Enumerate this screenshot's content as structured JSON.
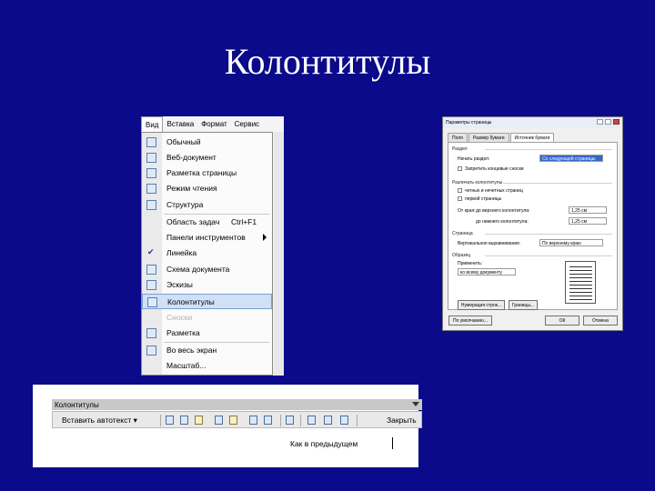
{
  "slide": {
    "title": "Колонтитулы"
  },
  "menu": {
    "menubar": [
      "Вид",
      "Вставка",
      "Формат",
      "Сервис"
    ],
    "items": [
      {
        "label": "Обычный",
        "shortcut": ""
      },
      {
        "label": "Веб-документ",
        "shortcut": ""
      },
      {
        "label": "Разметка страницы",
        "shortcut": ""
      },
      {
        "label": "Режим чтения",
        "shortcut": ""
      },
      {
        "label": "Структура",
        "shortcut": ""
      },
      {
        "label": "Область задач",
        "shortcut": "Ctrl+F1"
      },
      {
        "label": "Панели инструментов",
        "shortcut": ""
      },
      {
        "label": "Линейка",
        "shortcut": ""
      },
      {
        "label": "Схема документа",
        "shortcut": ""
      },
      {
        "label": "Эскизы",
        "shortcut": ""
      },
      {
        "label": "Колонтитулы",
        "shortcut": ""
      },
      {
        "label": "Сноски",
        "shortcut": ""
      },
      {
        "label": "Разметка",
        "shortcut": ""
      },
      {
        "label": "Во весь экран",
        "shortcut": ""
      },
      {
        "label": "Масштаб...",
        "shortcut": ""
      }
    ]
  },
  "dialog": {
    "title": "Параметры страницы",
    "tabs": [
      "Поля",
      "Размер бумаги",
      "Источник бумаги"
    ],
    "section_razdel": "Раздел",
    "nachat_razdel_label": "Начать раздел:",
    "nachat_razdel_value": "Со следующей страницы",
    "hide_endnotes": "Запретить концевые сноски",
    "section_kolontituly": "Различать колонтитулы",
    "odd_even": "четных и нечетных страниц",
    "first_page": "первой страницы",
    "from_edge": "От края:",
    "header_label": "до верхнего колонтитула:",
    "header_value": "1,25 см",
    "footer_label": "до нижнего колонтитула:",
    "footer_value": "1,25 см",
    "section_page": "Страница",
    "valign_label": "Вертикальное выравнивание:",
    "valign_value": "По верхнему краю",
    "section_sample": "Образец",
    "apply_label": "Применить:",
    "apply_value": "ко всему документу",
    "btn_numbering": "Нумерация строк...",
    "btn_borders": "Границы...",
    "btn_default": "По умолчанию...",
    "btn_ok": "ОК",
    "btn_cancel": "Отмена"
  },
  "toolbar": {
    "title": "Колонтитулы",
    "insert_autotext": "Вставить автотекст ▾",
    "close": "Закрыть",
    "same_as_previous": "Как в предыдущем"
  }
}
